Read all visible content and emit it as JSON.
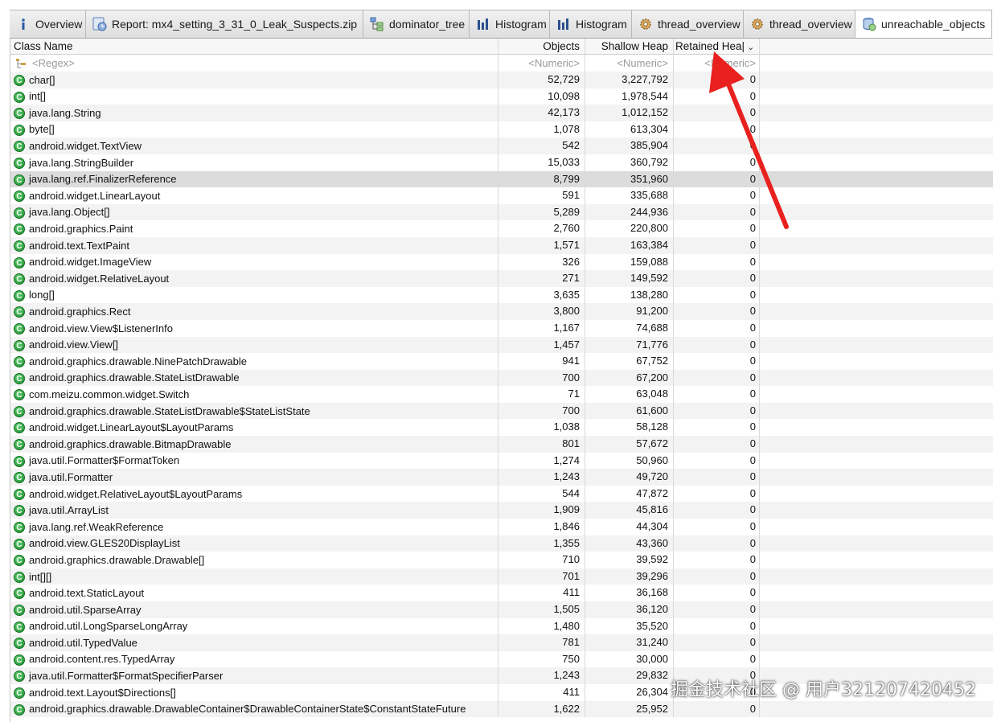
{
  "tabs": [
    {
      "label": "Overview",
      "icon": "info-icon",
      "width": 95
    },
    {
      "label": "Report: mx4_setting_3_31_0_Leak_Suspects.zip",
      "icon": "report-icon",
      "width": 345
    },
    {
      "label": "dominator_tree",
      "icon": "tree-icon",
      "width": 132
    },
    {
      "label": "Histogram",
      "icon": "histogram-icon",
      "width": 100
    },
    {
      "label": "Histogram",
      "icon": "histogram-icon",
      "width": 102
    },
    {
      "label": "thread_overview",
      "icon": "gear-icon",
      "width": 139
    },
    {
      "label": "thread_overview",
      "icon": "gear-icon",
      "width": 139
    },
    {
      "label": "unreachable_objects",
      "icon": "database-icon",
      "width": 170,
      "active": true
    }
  ],
  "columns": {
    "name": "Class Name",
    "objects": "Objects",
    "shallow": "Shallow Heap",
    "retained": "Retained Hea|"
  },
  "filters": {
    "name": "<Regex>",
    "objects": "<Numeric>",
    "shallow": "<Numeric>",
    "retained": "<Numeric>"
  },
  "icon_letter": "C",
  "rows": [
    {
      "name": "char[]",
      "objects": "52,729",
      "shallow": "3,227,792",
      "retained": "0"
    },
    {
      "name": "int[]",
      "objects": "10,098",
      "shallow": "1,978,544",
      "retained": "0"
    },
    {
      "name": "java.lang.String",
      "objects": "42,173",
      "shallow": "1,012,152",
      "retained": "0"
    },
    {
      "name": "byte[]",
      "objects": "1,078",
      "shallow": "613,304",
      "retained": "0"
    },
    {
      "name": "android.widget.TextView",
      "objects": "542",
      "shallow": "385,904",
      "retained": "0"
    },
    {
      "name": "java.lang.StringBuilder",
      "objects": "15,033",
      "shallow": "360,792",
      "retained": "0"
    },
    {
      "name": "java.lang.ref.FinalizerReference",
      "objects": "8,799",
      "shallow": "351,960",
      "retained": "0",
      "selected": true
    },
    {
      "name": "android.widget.LinearLayout",
      "objects": "591",
      "shallow": "335,688",
      "retained": "0"
    },
    {
      "name": "java.lang.Object[]",
      "objects": "5,289",
      "shallow": "244,936",
      "retained": "0"
    },
    {
      "name": "android.graphics.Paint",
      "objects": "2,760",
      "shallow": "220,800",
      "retained": "0"
    },
    {
      "name": "android.text.TextPaint",
      "objects": "1,571",
      "shallow": "163,384",
      "retained": "0"
    },
    {
      "name": "android.widget.ImageView",
      "objects": "326",
      "shallow": "159,088",
      "retained": "0"
    },
    {
      "name": "android.widget.RelativeLayout",
      "objects": "271",
      "shallow": "149,592",
      "retained": "0"
    },
    {
      "name": "long[]",
      "objects": "3,635",
      "shallow": "138,280",
      "retained": "0"
    },
    {
      "name": "android.graphics.Rect",
      "objects": "3,800",
      "shallow": "91,200",
      "retained": "0"
    },
    {
      "name": "android.view.View$ListenerInfo",
      "objects": "1,167",
      "shallow": "74,688",
      "retained": "0"
    },
    {
      "name": "android.view.View[]",
      "objects": "1,457",
      "shallow": "71,776",
      "retained": "0"
    },
    {
      "name": "android.graphics.drawable.NinePatchDrawable",
      "objects": "941",
      "shallow": "67,752",
      "retained": "0"
    },
    {
      "name": "android.graphics.drawable.StateListDrawable",
      "objects": "700",
      "shallow": "67,200",
      "retained": "0"
    },
    {
      "name": "com.meizu.common.widget.Switch",
      "objects": "71",
      "shallow": "63,048",
      "retained": "0"
    },
    {
      "name": "android.graphics.drawable.StateListDrawable$StateListState",
      "objects": "700",
      "shallow": "61,600",
      "retained": "0"
    },
    {
      "name": "android.widget.LinearLayout$LayoutParams",
      "objects": "1,038",
      "shallow": "58,128",
      "retained": "0"
    },
    {
      "name": "android.graphics.drawable.BitmapDrawable",
      "objects": "801",
      "shallow": "57,672",
      "retained": "0"
    },
    {
      "name": "java.util.Formatter$FormatToken",
      "objects": "1,274",
      "shallow": "50,960",
      "retained": "0"
    },
    {
      "name": "java.util.Formatter",
      "objects": "1,243",
      "shallow": "49,720",
      "retained": "0"
    },
    {
      "name": "android.widget.RelativeLayout$LayoutParams",
      "objects": "544",
      "shallow": "47,872",
      "retained": "0"
    },
    {
      "name": "java.util.ArrayList",
      "objects": "1,909",
      "shallow": "45,816",
      "retained": "0"
    },
    {
      "name": "java.lang.ref.WeakReference",
      "objects": "1,846",
      "shallow": "44,304",
      "retained": "0"
    },
    {
      "name": "android.view.GLES20DisplayList",
      "objects": "1,355",
      "shallow": "43,360",
      "retained": "0"
    },
    {
      "name": "android.graphics.drawable.Drawable[]",
      "objects": "710",
      "shallow": "39,592",
      "retained": "0"
    },
    {
      "name": "int[][]",
      "objects": "701",
      "shallow": "39,296",
      "retained": "0"
    },
    {
      "name": "android.text.StaticLayout",
      "objects": "411",
      "shallow": "36,168",
      "retained": "0"
    },
    {
      "name": "android.util.SparseArray",
      "objects": "1,505",
      "shallow": "36,120",
      "retained": "0"
    },
    {
      "name": "android.util.LongSparseLongArray",
      "objects": "1,480",
      "shallow": "35,520",
      "retained": "0"
    },
    {
      "name": "android.util.TypedValue",
      "objects": "781",
      "shallow": "31,240",
      "retained": "0"
    },
    {
      "name": "android.content.res.TypedArray",
      "objects": "750",
      "shallow": "30,000",
      "retained": "0"
    },
    {
      "name": "java.util.Formatter$FormatSpecifierParser",
      "objects": "1,243",
      "shallow": "29,832",
      "retained": "0"
    },
    {
      "name": "android.text.Layout$Directions[]",
      "objects": "411",
      "shallow": "26,304",
      "retained": "0"
    },
    {
      "name": "android.graphics.drawable.DrawableContainer$DrawableContainerState$ConstantStateFuture",
      "objects": "1,622",
      "shallow": "25,952",
      "retained": "0"
    }
  ],
  "watermark": "掘金技术社区 @ 用户321207420452",
  "colors": {
    "class_icon": "#1d8a2e",
    "arrow": "#e8201e",
    "selected_row": "#dcdcdc"
  }
}
